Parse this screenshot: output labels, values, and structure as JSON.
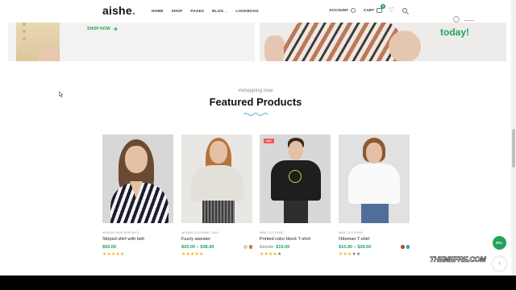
{
  "header": {
    "logo": "aishe",
    "logo_dot": ".",
    "nav": [
      {
        "label": "HOME",
        "dropdown": false
      },
      {
        "label": "SHOP",
        "dropdown": false
      },
      {
        "label": "PAGES",
        "dropdown": false
      },
      {
        "label": "BLOG",
        "dropdown": true
      },
      {
        "label": "LOOKBOOK",
        "dropdown": false
      }
    ],
    "account_label": "ACCOUNT",
    "cart_label": "CART",
    "cart_count": "0"
  },
  "banners": {
    "left_cta": "SHOP NOW",
    "right_text": "today!"
  },
  "section": {
    "subtitle": "#shopping now",
    "title": "Featured Products"
  },
  "products": [
    {
      "category": "WOMAN, NEW ARRIVALS",
      "name": "Striped shirt with belt",
      "price": "$50.00",
      "old_price": "",
      "rating": 5,
      "stars": "★★★★★",
      "stars_off": "",
      "sale": ""
    },
    {
      "category": "WOMAN CLOTHING, SALE",
      "name": "Fuzzy sweater",
      "price": "$20.00 – $38.90",
      "old_price": "",
      "rating": 5,
      "stars": "★★★★★",
      "stars_off": "",
      "sale": ""
    },
    {
      "category": "MAN, CLOTHING",
      "name": "Printed color block T-shirt",
      "price": "$19.00",
      "old_price": "$10.00",
      "rating": 4,
      "stars": "★★★★",
      "stars_off": "★",
      "sale": "sale"
    },
    {
      "category": "MAN, CLOTHING",
      "name": "Ottoman T-shirt",
      "price": "$15.90 – $29.00",
      "old_price": "",
      "rating": 3,
      "stars": "★★★",
      "stars_off": "★★",
      "sale": ""
    }
  ],
  "colors": {
    "accent": "#21a35c",
    "sale": "#ef5b5b",
    "star": "#f2b01e"
  },
  "swatches": {
    "fuzzy_sweater": [
      "#d9d0c4",
      "#c97a2e"
    ],
    "ottoman_tshirt": [
      "#a0522d",
      "#2aa7b8"
    ]
  },
  "chrome": {
    "rtl_label": "RTL",
    "top_icon": "↑",
    "watermark": "THEMEFRE.COM"
  }
}
